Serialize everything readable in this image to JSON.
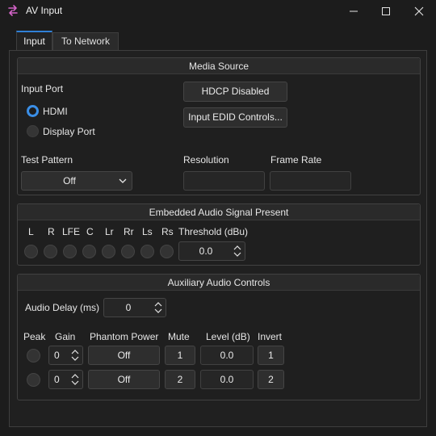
{
  "window": {
    "title": "AV Input"
  },
  "tabs": [
    {
      "label": "Input"
    },
    {
      "label": "To Network"
    }
  ],
  "media_source": {
    "header": "Media Source",
    "input_port_label": "Input Port",
    "radios": [
      {
        "label": "HDMI",
        "selected": true
      },
      {
        "label": "Display Port",
        "selected": false
      }
    ],
    "hdcp_button": "HDCP Disabled",
    "edid_button": "Input EDID Controls...",
    "test_pattern_label": "Test Pattern",
    "test_pattern_value": "Off",
    "resolution_label": "Resolution",
    "resolution_value": "",
    "frame_rate_label": "Frame Rate",
    "frame_rate_value": ""
  },
  "embedded_audio": {
    "header": "Embedded Audio Signal Present",
    "channels": [
      "L",
      "R",
      "LFE",
      "C",
      "Lr",
      "Rr",
      "Ls",
      "Rs"
    ],
    "threshold_label": "Threshold (dBu)",
    "threshold_value": "0.0"
  },
  "aux_audio": {
    "header": "Auxiliary Audio Controls",
    "delay_label": "Audio Delay (ms)",
    "delay_value": "0",
    "columns": {
      "peak": "Peak",
      "gain": "Gain",
      "phantom": "Phantom Power",
      "mute": "Mute",
      "level": "Level (dB)",
      "invert": "Invert"
    },
    "rows": [
      {
        "gain": "0",
        "phantom": "Off",
        "mute": "1",
        "level": "0.0",
        "invert": "1"
      },
      {
        "gain": "0",
        "phantom": "Off",
        "mute": "2",
        "level": "0.0",
        "invert": "2"
      }
    ]
  },
  "colors": {
    "accent": "#3a8ee6",
    "app_icon": "#d463c8",
    "background": "#1c1c1c"
  }
}
